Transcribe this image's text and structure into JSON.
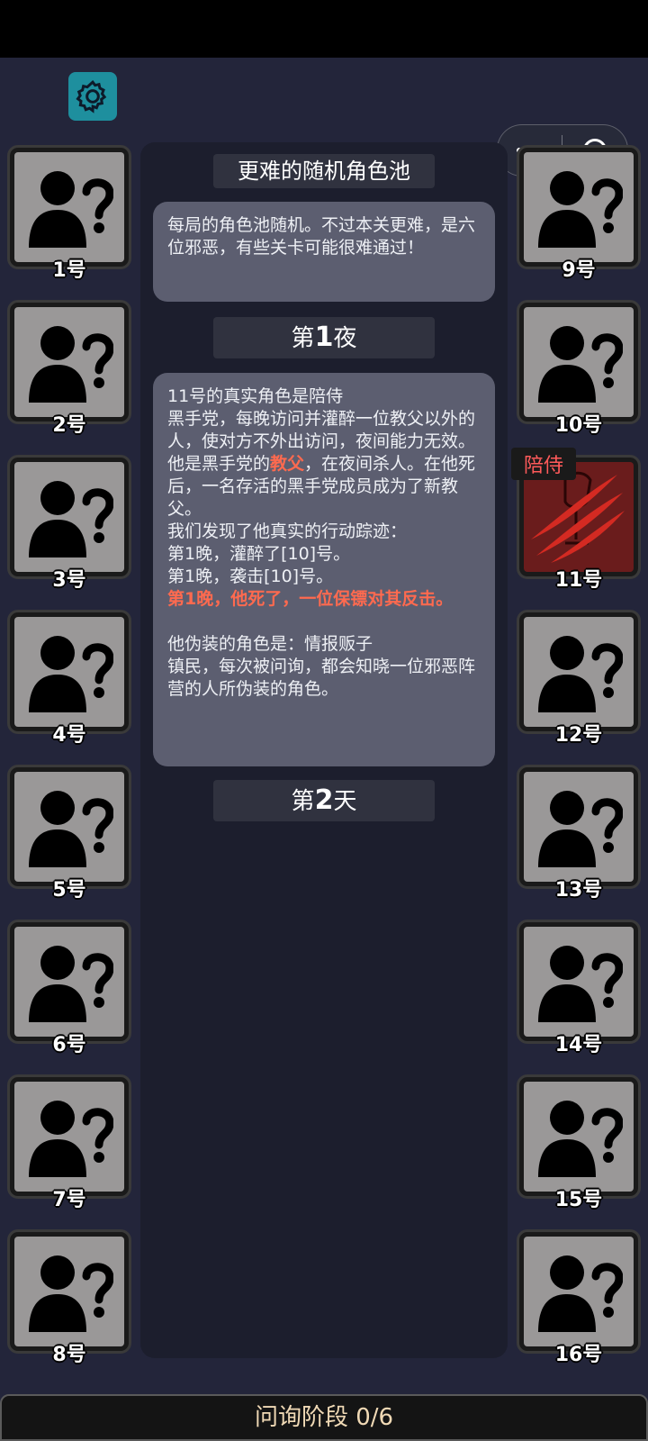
{
  "pool_title": "更难的随机角色池",
  "pool_description": "每局的角色池随机。不过本关更难，是六位邪恶，有些关卡可能很难通过！",
  "night_header": {
    "prefix": "第",
    "num": "1",
    "suffix": "夜"
  },
  "day_header": {
    "prefix": "第",
    "num": "2",
    "suffix": "天"
  },
  "info": {
    "line1": "11号的真实角色是陪侍",
    "line2": "黑手党，每晚访问并灌醉一位教父以外的人，使对方不外出访问，夜间能力无效。",
    "line3_a": "他是黑手党的",
    "line3_hl": "教父",
    "line3_b": "，在夜间杀人。在他死后，一名存活的黑手党成员成为了新教父。",
    "line4": "我们发现了他真实的行动踪迹：",
    "line5": "第1晚，灌醉了[10]号。",
    "line6": "第1晚，袭击[10]号。",
    "line7": "第1晚，他死了，一位保镖对其反击。",
    "line8": "他伪装的角色是：情报贩子",
    "line9": "镇民，每次被问询，都会知晓一位邪恶阵营的人所伪装的角色。"
  },
  "revealed_role_tag": "陪侍",
  "players_left": [
    "1号",
    "2号",
    "3号",
    "4号",
    "5号",
    "6号",
    "7号",
    "8号"
  ],
  "players_right": [
    "9号",
    "10号",
    "11号",
    "12号",
    "13号",
    "14号",
    "15号",
    "16号"
  ],
  "phase_status": "问询阶段 0/6",
  "colors": {
    "accent_red": "#ff6a4f",
    "settings_teal": "#1e8f9e",
    "status_text": "#f0d9b5"
  },
  "icons": {
    "settings": "gear-icon",
    "unknown": "unknown-player-icon",
    "revealed": "claw-slash-icon"
  }
}
